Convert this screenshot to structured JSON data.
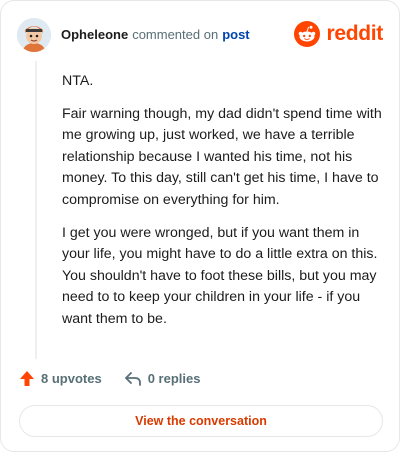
{
  "header": {
    "username": "Opheleone",
    "verb": "commented on",
    "post_link": "post",
    "brand": "reddit"
  },
  "comment": {
    "paragraphs": [
      "NTA.",
      "Fair warning though, my dad didn't spend time with me growing up, just worked, we have a terrible relationship because I wanted his time, not his money. To this day, still can't get his time, I have to compromise on everything for him.",
      "I get you were wronged, but if you want them in your life, you might have to do a little extra on this. You shouldn't have to foot these bills, but you may need to to keep your children in your life - if you want them to be."
    ]
  },
  "actions": {
    "upvotes": "8 upvotes",
    "replies": "0 replies"
  },
  "cta": {
    "label": "View the conversation"
  },
  "colors": {
    "accent": "#ff4500",
    "cta_text": "#d93a00",
    "link": "#0045ac"
  }
}
